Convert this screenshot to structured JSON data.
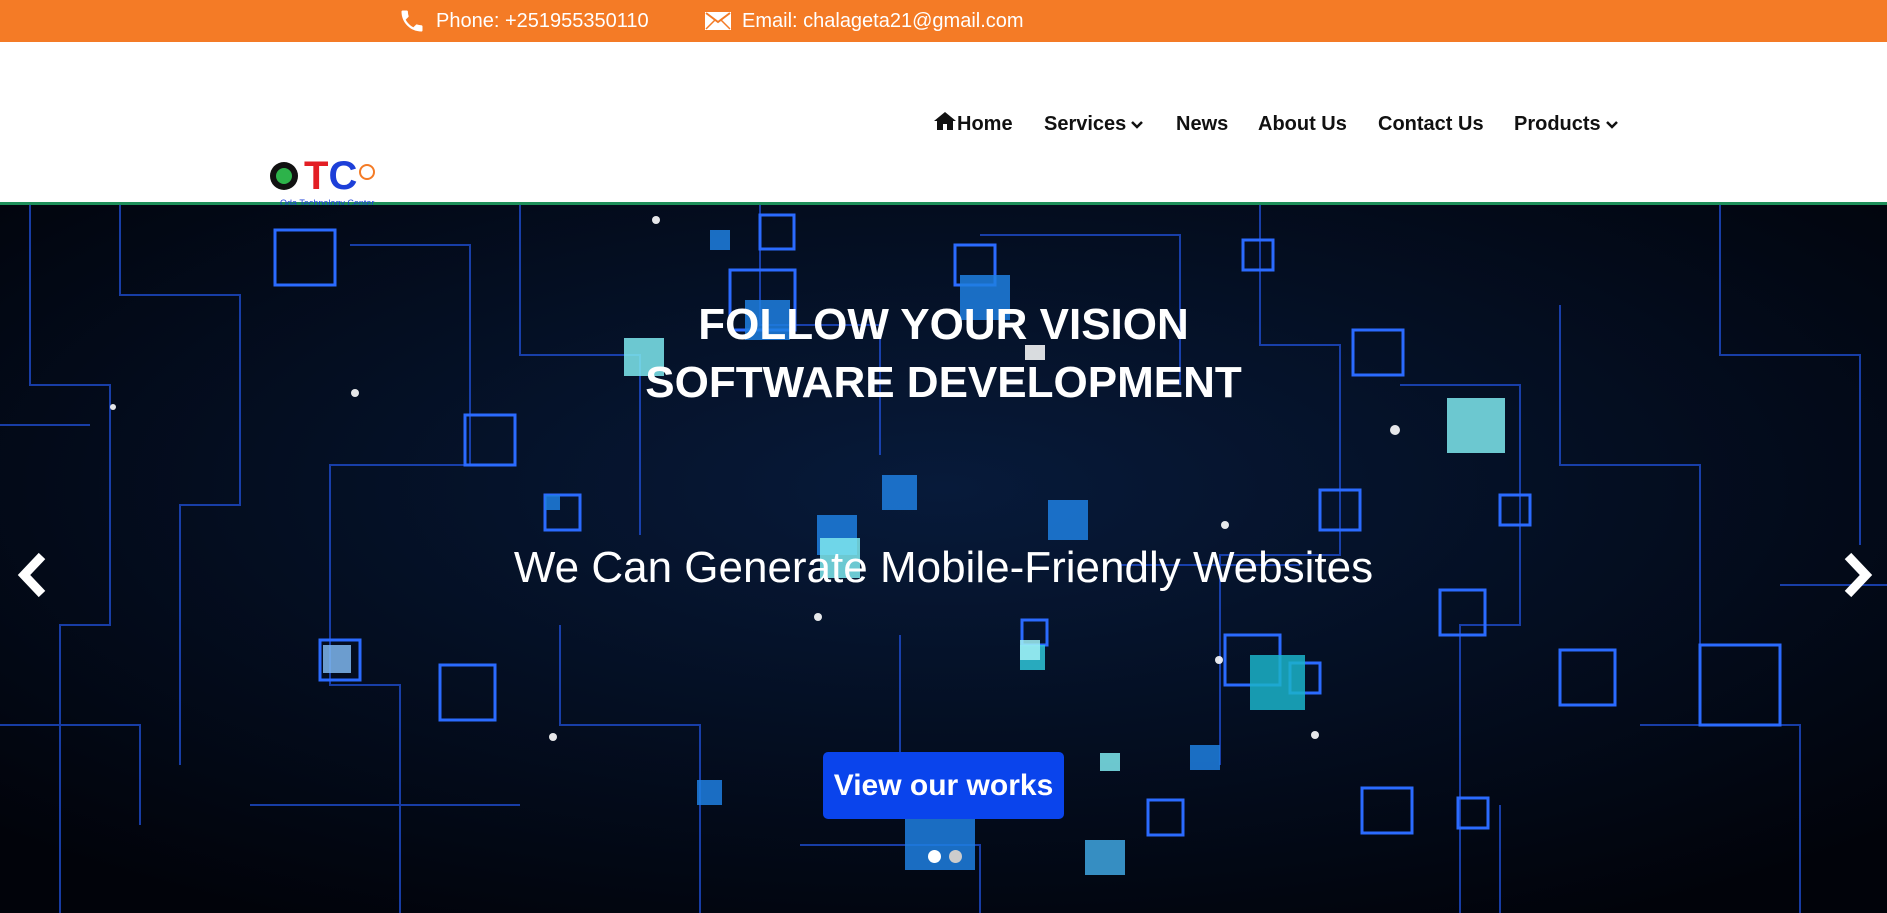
{
  "topbar": {
    "phone_icon": "phone-icon",
    "phone_text": "Phone: +251955350110",
    "email_icon": "envelope-icon",
    "email_text": "Email: chalageta21@gmail.com",
    "background": "#f47b26"
  },
  "logo": {
    "letter_o": "O",
    "letter_t": "T",
    "letter_c": "C",
    "tagline": "Oda Technology Center"
  },
  "nav": {
    "home_icon": "home-icon",
    "home": "Home",
    "services": "Services",
    "news": "News",
    "about": "About Us",
    "contact": "Contact Us",
    "products": "Products"
  },
  "hero": {
    "headline_line1": "FOLLOW YOUR VISION",
    "headline_line2": "SOFTWARE DEVELOPMENT",
    "subheadline": "We Can Generate Mobile-Friendly Websites",
    "cta_label": "View our works",
    "prev_icon": "chevron-left-icon",
    "next_icon": "chevron-right-icon",
    "slide_count": 2,
    "active_slide": 1
  },
  "colors": {
    "accent_orange": "#f47b26",
    "cta_blue": "#0a44ec",
    "divider_green": "#1e8f5a",
    "logo_green": "#2db34a",
    "logo_red": "#e31e24",
    "logo_blue": "#1d3fd8"
  }
}
